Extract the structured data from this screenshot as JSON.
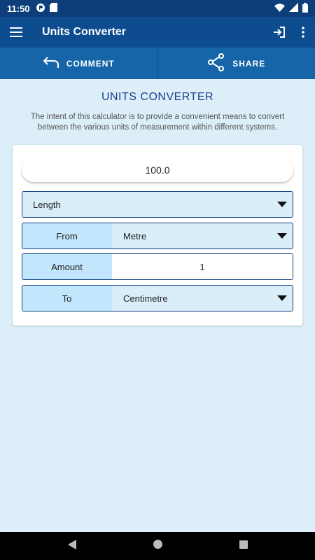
{
  "status_bar": {
    "time": "11:50"
  },
  "app_bar": {
    "title": "Units Converter"
  },
  "actions": {
    "comment_label": "COMMENT",
    "share_label": "SHARE"
  },
  "page": {
    "heading": "UNITS CONVERTER",
    "intro": "The intent of this calculator is to provide a convenient means to convert between the various units of measurement within different systems."
  },
  "converter": {
    "result": "100.0",
    "category": "Length",
    "from_label": "From",
    "from_value": "Metre",
    "amount_label": "Amount",
    "amount_value": "1",
    "to_label": "To",
    "to_value": "Centimetre"
  },
  "colors": {
    "status_bar": "#0d3e7a",
    "app_bar": "#0d4d8f",
    "action_bar": "#1565a8",
    "background": "#dceef8",
    "heading": "#1a3e8f"
  }
}
